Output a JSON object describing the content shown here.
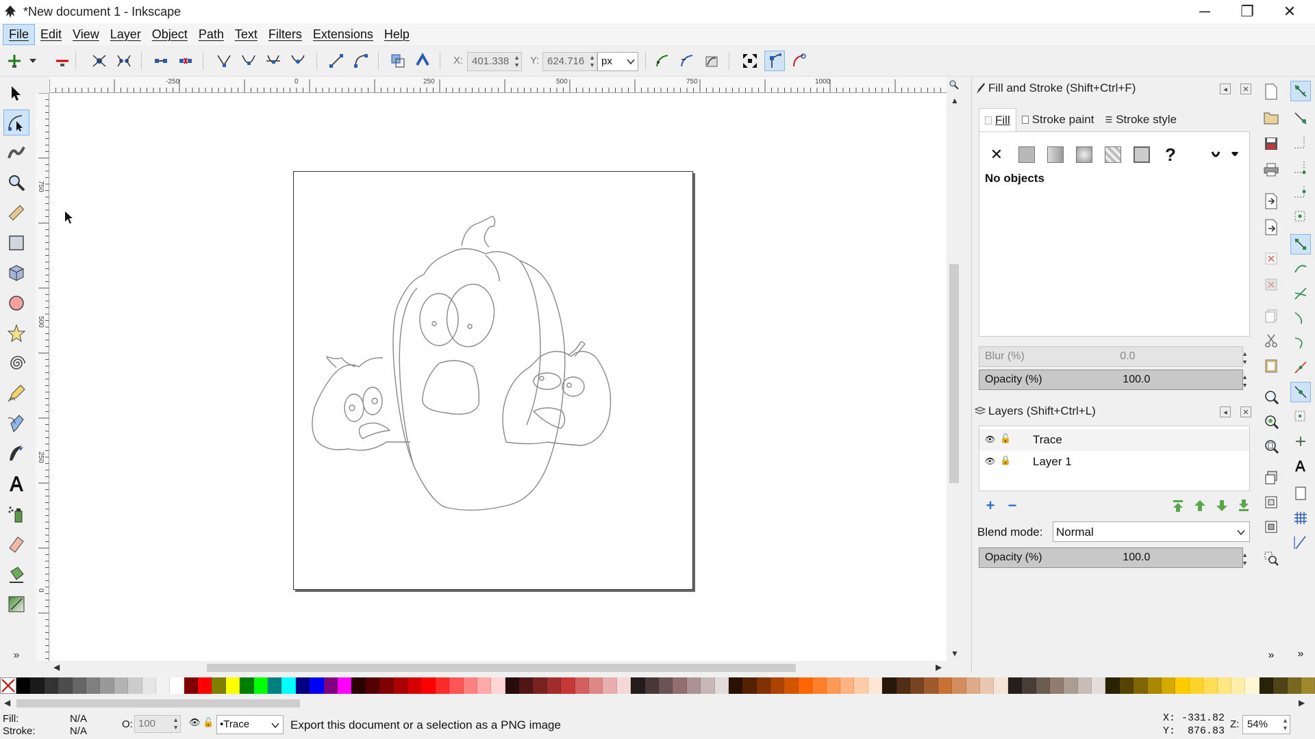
{
  "window": {
    "title": "*New document 1 - Inkscape",
    "minimize_glyph": "─",
    "maximize_glyph": "❐",
    "close_glyph": "✕"
  },
  "menu": [
    "File",
    "Edit",
    "View",
    "Layer",
    "Object",
    "Path",
    "Text",
    "Filters",
    "Extensions",
    "Help"
  ],
  "tool_controls": {
    "x_label": "X:",
    "x_value": "401.338",
    "y_label": "Y:",
    "y_value": "624.716",
    "unit": "px"
  },
  "ruler": {
    "h_labels": [
      "-250",
      "0",
      "250",
      "500",
      "750",
      "1000"
    ],
    "v_labels": [
      "750",
      "500",
      "250",
      "0"
    ]
  },
  "fill_stroke": {
    "title": "Fill and Stroke (Shift+Ctrl+F)",
    "tabs": [
      "Fill",
      "Stroke paint",
      "Stroke style"
    ],
    "unknown_glyph": "?",
    "unset_glyph": "✕",
    "status": "No objects",
    "blur_label": "Blur (%)",
    "blur_value": "0.0",
    "opacity_label": "Opacity (%)",
    "opacity_value": "100.0"
  },
  "layers": {
    "title": "Layers (Shift+Ctrl+L)",
    "items": [
      {
        "name": "Trace"
      },
      {
        "name": "Layer 1"
      }
    ],
    "blend_label": "Blend mode:",
    "blend_value": "Normal",
    "opacity_label": "Opacity (%)",
    "opacity_value": "100.0"
  },
  "palette": {
    "colors": [
      "#000000",
      "#1a1a1a",
      "#333333",
      "#4d4d4d",
      "#666666",
      "#808080",
      "#999999",
      "#b3b3b3",
      "#cccccc",
      "#e6e6e6",
      "#f2f2f2",
      "#ffffff",
      "#800000",
      "#ff0000",
      "#808000",
      "#ffff00",
      "#008000",
      "#00ff00",
      "#008080",
      "#00ffff",
      "#000080",
      "#0000ff",
      "#800080",
      "#ff00ff",
      "#2b0000",
      "#550000",
      "#800000",
      "#aa0000",
      "#d40000",
      "#ff0000",
      "#ff2a2a",
      "#ff5555",
      "#ff8080",
      "#ffaaaa",
      "#ffd5d5",
      "#280b0b",
      "#501616",
      "#782121",
      "#a02c2c",
      "#c83737",
      "#d35f5f",
      "#de8787",
      "#e9afaf",
      "#f4d7d7",
      "#241c1c",
      "#483737",
      "#6c5353",
      "#916f6f",
      "#ac9393",
      "#c8b7b7",
      "#e3dbdb",
      "#2b1100",
      "#552200",
      "#803300",
      "#aa4400",
      "#d45500",
      "#ff6600",
      "#ff7f2a",
      "#ff9955",
      "#ffb380",
      "#ffccaa",
      "#ffe6d5",
      "#28170b",
      "#502d16",
      "#784421",
      "#a05a2c",
      "#c87137",
      "#d38d5f",
      "#deaa87",
      "#e9c6af",
      "#f4e3d7",
      "#241f1c",
      "#483e37",
      "#6c5d53",
      "#917c6f",
      "#ac9d93",
      "#c8beb7",
      "#e3dedb",
      "#2b2200",
      "#554400",
      "#806600",
      "#aa8800",
      "#d4aa00",
      "#ffcc00",
      "#ffd42a",
      "#ffdd55",
      "#ffe680",
      "#ffeeaa",
      "#fff6d5",
      "#28220b",
      "#504416",
      "#786721",
      "#a0892c"
    ]
  },
  "status": {
    "fill_label": "Fill:",
    "fill_value": "N/A",
    "stroke_label": "Stroke:",
    "stroke_value": "N/A",
    "opacity_label": "O:",
    "opacity_value": "100",
    "layer": "•Trace",
    "message": "Export this document or a selection as a PNG image",
    "cursor_x": "X: -331.82",
    "cursor_y": "Y:  876.83",
    "zoom_label": "Z:",
    "zoom_value": "54%"
  }
}
